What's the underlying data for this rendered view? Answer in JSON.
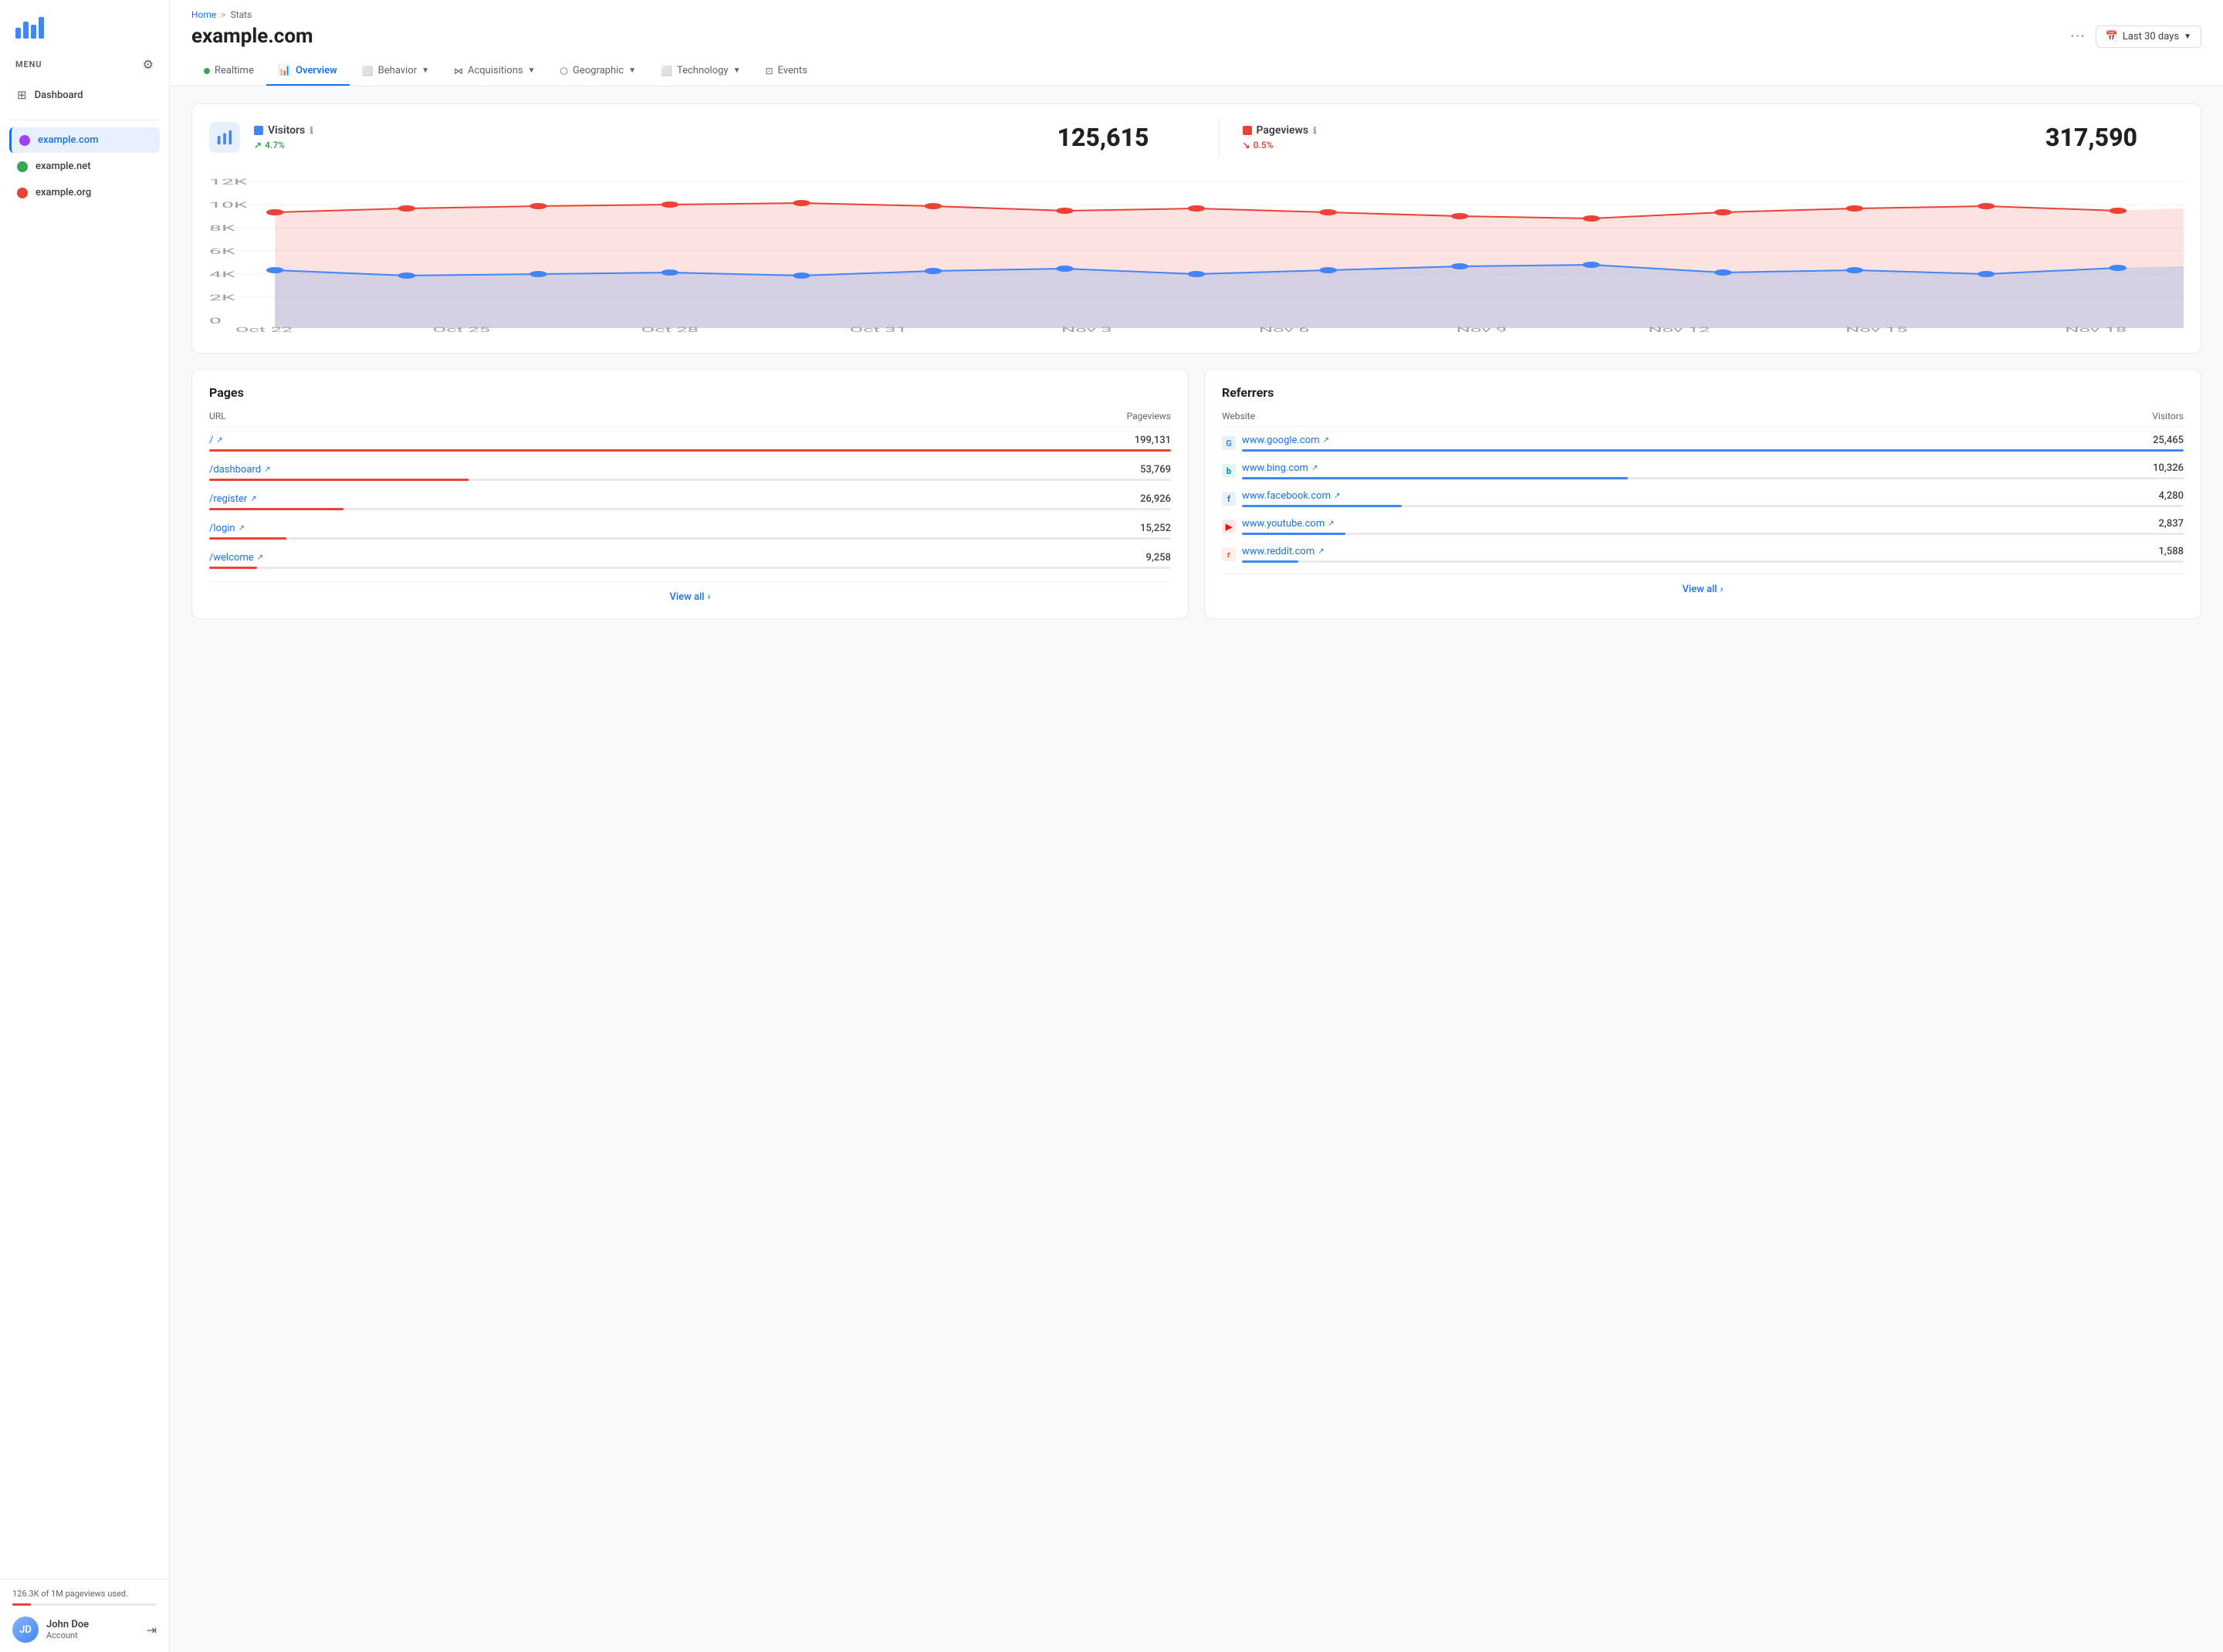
{
  "sidebar": {
    "menu_label": "MENU",
    "dashboard_label": "Dashboard",
    "sites": [
      {
        "name": "example.com",
        "color": "#a142f4",
        "active": true
      },
      {
        "name": "example.net",
        "color": "#34a853",
        "active": false
      },
      {
        "name": "example.org",
        "color": "#ea4335",
        "active": false
      }
    ],
    "usage_text": "126.3K of 1M pageviews used.",
    "usage_percent": 12.63,
    "user": {
      "name": "John Doe",
      "role": "Account"
    }
  },
  "header": {
    "breadcrumb_home": "Home",
    "breadcrumb_sep": ">",
    "breadcrumb_current": "Stats",
    "page_title": "example.com",
    "dots": "···",
    "date_label": "Last 30 days"
  },
  "tabs": [
    {
      "id": "realtime",
      "label": "Realtime",
      "has_dot": true,
      "has_caret": false,
      "active": false
    },
    {
      "id": "overview",
      "label": "Overview",
      "has_dot": false,
      "has_caret": false,
      "active": true
    },
    {
      "id": "behavior",
      "label": "Behavior",
      "has_dot": false,
      "has_caret": true,
      "active": false
    },
    {
      "id": "acquisitions",
      "label": "Acquisitions",
      "has_dot": false,
      "has_caret": true,
      "active": false
    },
    {
      "id": "geographic",
      "label": "Geographic",
      "has_dot": false,
      "has_caret": true,
      "active": false
    },
    {
      "id": "technology",
      "label": "Technology",
      "has_dot": false,
      "has_caret": true,
      "active": false
    },
    {
      "id": "events",
      "label": "Events",
      "has_dot": false,
      "has_caret": false,
      "active": false
    }
  ],
  "metrics": {
    "visitors_label": "Visitors",
    "visitors_value": "125,615",
    "visitors_change": "4.7%",
    "visitors_up": true,
    "visitors_color": "#4285f4",
    "pageviews_label": "Pageviews",
    "pageviews_value": "317,590",
    "pageviews_change": "0.5%",
    "pageviews_up": false,
    "pageviews_color": "#ea4335"
  },
  "chart": {
    "x_labels": [
      "Oct 22",
      "Oct 25",
      "Oct 28",
      "Oct 31",
      "Nov 3",
      "Nov 6",
      "Nov 9",
      "Nov 12",
      "Nov 15",
      "Nov 18"
    ],
    "y_labels": [
      "12K",
      "10K",
      "8K",
      "6K",
      "4K",
      "2K",
      "0"
    ],
    "visitors_color": "#4285f4",
    "pageviews_color": "#ea4335"
  },
  "pages_panel": {
    "title": "Pages",
    "col_url": "URL",
    "col_val": "Pageviews",
    "rows": [
      {
        "url": "/",
        "value": "199,131",
        "bar_pct": 100,
        "color": "#ea4335"
      },
      {
        "url": "/dashboard",
        "value": "53,769",
        "bar_pct": 27,
        "color": "#ea4335"
      },
      {
        "url": "/register",
        "value": "26,926",
        "bar_pct": 14,
        "color": "#ea4335"
      },
      {
        "url": "/login",
        "value": "15,252",
        "bar_pct": 8,
        "color": "#ea4335"
      },
      {
        "url": "/welcome",
        "value": "9,258",
        "bar_pct": 5,
        "color": "#ea4335"
      }
    ],
    "view_all": "View all"
  },
  "referrers_panel": {
    "title": "Referrers",
    "col_website": "Website",
    "col_val": "Visitors",
    "rows": [
      {
        "name": "www.google.com",
        "value": "25,465",
        "bar_pct": 100,
        "color": "#4285f4",
        "icon": "G",
        "icon_color": "#4285f4",
        "icon_bg": "#e8f0fe"
      },
      {
        "name": "www.bing.com",
        "value": "10,326",
        "bar_pct": 41,
        "color": "#4285f4",
        "icon": "b",
        "icon_color": "#00809d",
        "icon_bg": "#e3f4f7"
      },
      {
        "name": "www.facebook.com",
        "value": "4,280",
        "bar_pct": 17,
        "color": "#4285f4",
        "icon": "f",
        "icon_color": "#1877f2",
        "icon_bg": "#e7f0fd"
      },
      {
        "name": "www.youtube.com",
        "value": "2,837",
        "bar_pct": 11,
        "color": "#4285f4",
        "icon": "▶",
        "icon_color": "#ff0000",
        "icon_bg": "#fde8e8"
      },
      {
        "name": "www.reddit.com",
        "value": "1,588",
        "bar_pct": 6,
        "color": "#4285f4",
        "icon": "r",
        "icon_color": "#ff4500",
        "icon_bg": "#fdeee8"
      }
    ],
    "view_all": "View all"
  }
}
